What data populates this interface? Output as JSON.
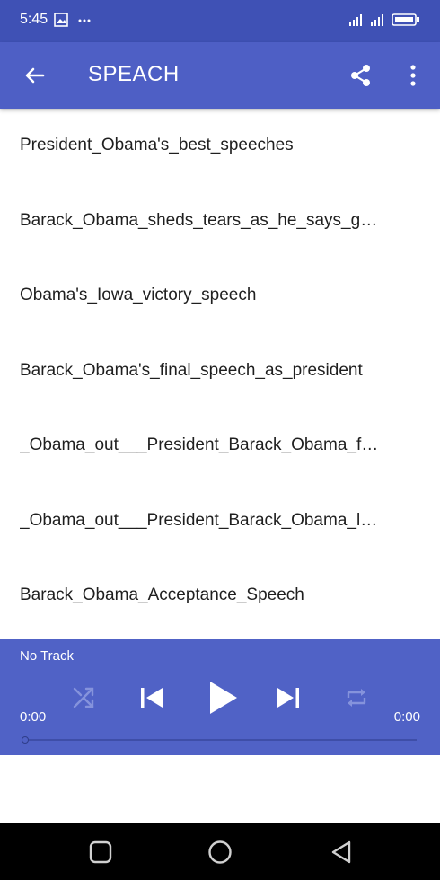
{
  "status_bar": {
    "time": "5:45",
    "icons": [
      "image-icon",
      "more-dots-icon",
      "signal-icon",
      "signal-icon",
      "battery-icon"
    ]
  },
  "app_bar": {
    "title": "SPEACH",
    "icons": [
      "back-arrow-icon",
      "share-icon",
      "more-vert-icon"
    ]
  },
  "list": {
    "items": [
      "President_Obama's_best_speeches",
      "Barack_Obama_sheds_tears_as_he_says_goodbye",
      "Obama's_Iowa_victory_speech",
      "Barack_Obama's_final_speech_as_president",
      "_Obama_out___President_Barack_Obama_farewell",
      "_Obama_out___President_Barack_Obama_last_speech",
      "Barack_Obama_Acceptance_Speech"
    ]
  },
  "player": {
    "track_title": "No Track",
    "current_time": "0:00",
    "total_time": "0:00",
    "progress": 0,
    "icons": [
      "shuffle-icon",
      "skip-previous-icon",
      "play-icon",
      "skip-next-icon",
      "repeat-icon"
    ]
  },
  "nav_bar": {
    "icons": [
      "recents-square-icon",
      "home-circle-icon",
      "back-triangle-icon"
    ]
  }
}
